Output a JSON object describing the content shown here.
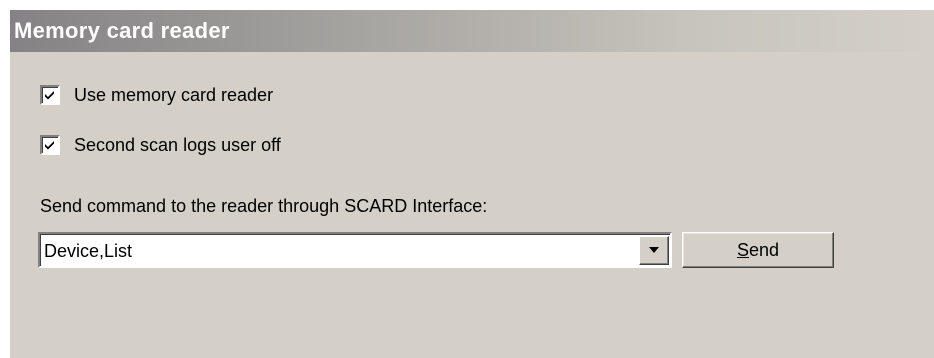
{
  "header": {
    "title": "Memory card reader"
  },
  "options": {
    "use_reader": {
      "label": "Use memory card reader",
      "checked": true
    },
    "second_scan": {
      "label": "Second scan logs user off",
      "checked": true
    }
  },
  "command": {
    "label": "Send command to the reader through SCARD Interface:",
    "selected_value": "Device,List",
    "send_button": {
      "mnemonic": "S",
      "rest": "end"
    }
  },
  "icons": {
    "checkbox_check": "checkmark-icon",
    "dropdown_arrow": "chevron-down-icon"
  },
  "colors": {
    "panel_bg": "#d4d0c8",
    "header_text": "#ffffff",
    "header_gradient_start": "#848284"
  }
}
